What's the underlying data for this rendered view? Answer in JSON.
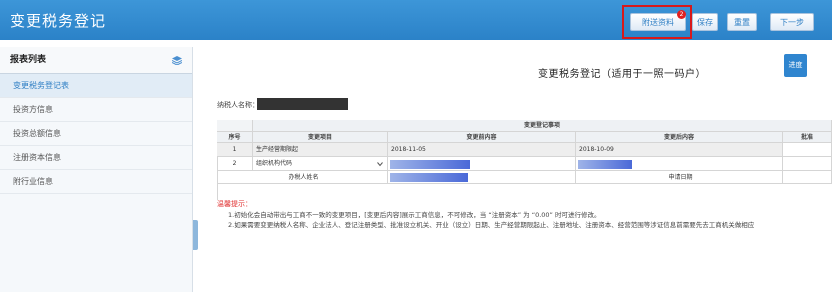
{
  "app": {
    "title": "变更税务登记"
  },
  "toolbar": {
    "send_label": "附送资料",
    "send_badge": "2",
    "save_label": "保存",
    "reset_label": "重置",
    "next_label": "下一步"
  },
  "sidebar": {
    "title": "报表列表",
    "items": [
      {
        "label": "变更税务登记表"
      },
      {
        "label": "投资方信息"
      },
      {
        "label": "投资总额信息"
      },
      {
        "label": "注册资本信息"
      },
      {
        "label": "附行业信息"
      }
    ]
  },
  "form": {
    "title": "变更税务登记（适用于一照一码户）",
    "progress_label": "进度",
    "taxpayer_label": "纳税人名称：",
    "group_header": "变更登记事项",
    "headers": [
      "序号",
      "变更项目",
      "变更前内容",
      "变更后内容",
      "批准"
    ],
    "rows": [
      {
        "no": "1",
        "item": "生产经营期限起",
        "before": "2018-11-05",
        "after": "2018-10-09"
      },
      {
        "no": "2",
        "item": "组织机构代码",
        "before": "",
        "after": ""
      }
    ],
    "agent_label": "办税人姓名",
    "apply_date_label": "申请日期"
  },
  "notes": {
    "title": "温馨提示：",
    "line1": "1.初始化会自动带出与工商不一致的变更项目，[变更后内容]展示工商信息，不可修改，当 “注册资本” 为 “0.00” 时可进行修改。",
    "line2": "2.如果需要变更纳税人名称、企业法人、登记注册类型、批准设立机关、开业（设立）日期、生产经营期限起止、注册地址、注册资本、经营范围等涉证信息前需要先去工商机关做相应"
  },
  "colors": {
    "topbar": "#2b82c8",
    "highlight": "#d7191b",
    "accent": "#2d7ec4"
  }
}
